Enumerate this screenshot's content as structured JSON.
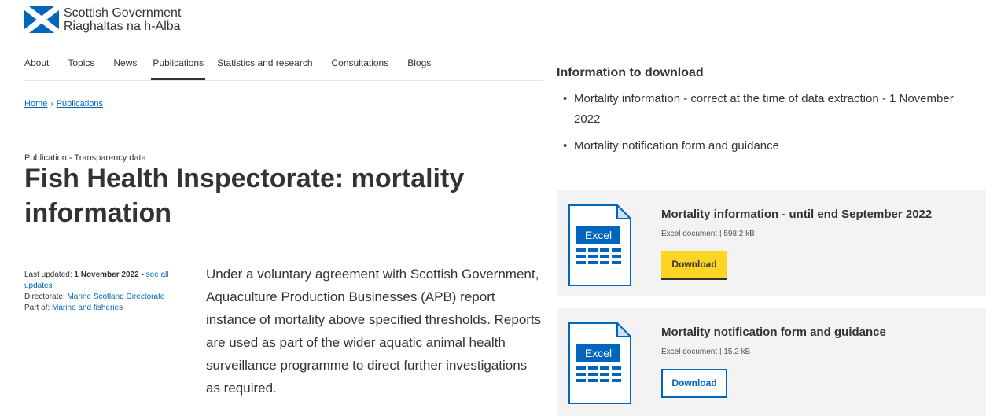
{
  "brand": {
    "name_line1": "Scottish Government",
    "name_line2": "Riaghaltas na h-Alba",
    "flag_blue": "#0065bd"
  },
  "nav": {
    "items": [
      {
        "label": "About"
      },
      {
        "label": "Topics"
      },
      {
        "label": "News"
      },
      {
        "label": "Publications",
        "active": true
      },
      {
        "label": "Statistics and research"
      },
      {
        "label": "Consultations"
      },
      {
        "label": "Blogs"
      }
    ]
  },
  "breadcrumb": {
    "items": [
      {
        "label": "Home"
      },
      {
        "label": "Publications"
      }
    ],
    "separator": "›"
  },
  "publication": {
    "label": "Publication - Transparency data",
    "title": "Fish Health Inspectorate: mortality information"
  },
  "meta": {
    "last_updated_label": "Last updated:",
    "last_updated_value": "1 November 2022",
    "last_updated_sep": " - ",
    "see_all_updates": "see all updates",
    "directorate_label": "Directorate:",
    "directorate_value": "Marine Scotland Directorate",
    "part_of_label": "Part of:",
    "part_of_value": "Marine and fisheries"
  },
  "summary": "Under a voluntary agreement with Scottish Government, Aquaculture Production Businesses (APB) report instance of mortality above specified thresholds. Reports are used as part of the wider aquatic animal health surveillance programme to direct further investigations as required.",
  "downloads": {
    "heading": "Information to download",
    "list": [
      "Mortality information - correct at the time of data extraction - 1 November 2022",
      "Mortality notification form and guidance"
    ],
    "cards": [
      {
        "title": "Mortality information - until end September 2022",
        "type": "Excel document",
        "sep": "|",
        "size": "598.2 kB",
        "icon_label": "Excel",
        "button": "Download",
        "button_style": "primary"
      },
      {
        "title": "Mortality notification form and guidance",
        "type": "Excel document",
        "sep": "|",
        "size": "15.2 kB",
        "icon_label": "Excel",
        "button": "Download",
        "button_style": "secondary"
      }
    ]
  },
  "colors": {
    "link": "#0065bd",
    "primary_button": "#fdd522",
    "card_bg": "#f3f3f3",
    "text": "#333333"
  }
}
